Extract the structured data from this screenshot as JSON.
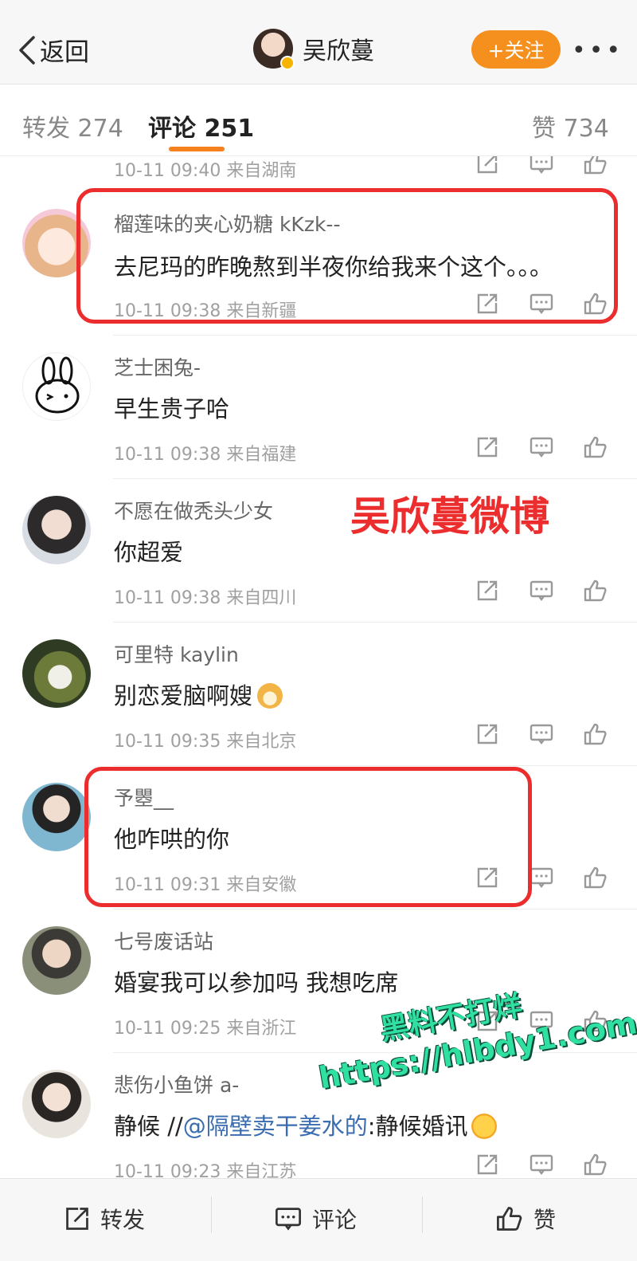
{
  "header": {
    "back_label": "返回",
    "title": "吴欣蔓",
    "follow_label": "+关注",
    "more_label": "•••"
  },
  "tabs": [
    {
      "label": "转发 274"
    },
    {
      "label": "评论 251"
    },
    {
      "label": "赞 734"
    }
  ],
  "top_partial_meta": "10-11 09:40 来自湖南",
  "comments": [
    {
      "name": "榴莲味的夹心奶糖 kKzk--",
      "text": "去尼玛的昨晚熬到半夜你给我来个这个。。。",
      "meta": "10-11 09:38 来自新疆"
    },
    {
      "name": "芝士困兔-",
      "text": "早生贵子哈",
      "meta": "10-11 09:38 来自福建"
    },
    {
      "name": "不愿在做秃头少女",
      "text": "你超爱",
      "meta": "10-11 09:38 来自四川"
    },
    {
      "name": "可里特 kaylin",
      "text": "别恋爱脑啊嫂",
      "meta": "10-11 09:35 来自北京"
    },
    {
      "name": "予瞾__",
      "text": "他咋哄的你",
      "meta": "10-11 09:31 来自安徽"
    },
    {
      "name": "七号废话站",
      "text": "婚宴我可以参加吗 我想吃席",
      "meta": "10-11 09:25 来自浙江"
    },
    {
      "name": "悲伤小鱼饼 a-",
      "text_prefix": "静候 //",
      "mention": "@隔壁卖干姜水的",
      "text_suffix": ":静候婚讯",
      "meta": "10-11 09:23 来自江苏"
    }
  ],
  "overlays": {
    "watermark": "吴欣蔓微博",
    "promo_line1": "黑料不打烊",
    "promo_line2": "https://hlbdy1.com"
  },
  "bottom_bar": {
    "repost": "转发",
    "comment": "评论",
    "like": "赞"
  },
  "colors": {
    "accent_orange": "#f5901e",
    "highlight_red": "#ec2d2d",
    "mention_blue": "#3a6cb0"
  }
}
